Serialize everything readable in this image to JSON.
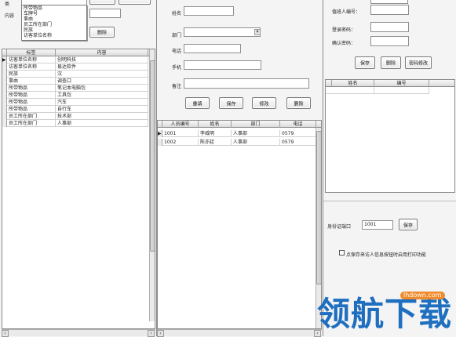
{
  "left": {
    "type_label": "类",
    "content_label": "内容",
    "combo_value": "",
    "dropdown_options": [
      "所带物品",
      "车牌号",
      "事由",
      "员工所在部门",
      "民族",
      "访客单位名称"
    ],
    "btn_top1": "",
    "btn_top2": "",
    "delete_label": "删除",
    "grid": {
      "headers": [
        "标签",
        "内容"
      ],
      "rows": [
        [
          "访客单位名称",
          "创明科技"
        ],
        [
          "访客单位名称",
          "易达软件"
        ],
        [
          "民族",
          "汉"
        ],
        [
          "事由",
          "调查口"
        ],
        [
          "所带物品",
          "笔记本电脑包"
        ],
        [
          "所带物品",
          "工具包"
        ],
        [
          "所带物品",
          "汽车"
        ],
        [
          "所带物品",
          "自行车"
        ],
        [
          "员工所在部门",
          "技术部"
        ],
        [
          "员工所在部门",
          "人事部"
        ]
      ]
    }
  },
  "middle": {
    "name_label": "姓名",
    "dept_label": "部门",
    "phone_label": "电话",
    "mobile_label": "手机",
    "remark_label": "备注",
    "buttons": {
      "reset": "重填",
      "save": "保存",
      "modify": "修改",
      "delete": "删除"
    },
    "grid": {
      "headers": [
        "人员编号",
        "姓名",
        "部门",
        "电话"
      ],
      "rows": [
        [
          "1001",
          "李威明",
          "人事部",
          "0579"
        ],
        [
          "1002",
          "陈亦廷",
          "人事部",
          "0579"
        ]
      ]
    }
  },
  "right": {
    "id_label": "值班人编号：",
    "login_pwd_label": "登录密码：",
    "confirm_pwd_label": "确认密码：",
    "buttons": {
      "save": "保存",
      "delete": "删除",
      "change_pwd": "密码修改"
    },
    "grid": {
      "headers": [
        "姓名",
        "编号"
      ]
    },
    "id_port_label": "身份证端口",
    "id_port_value": "1001",
    "id_port_save": "保存",
    "print_checkbox_label": "点保存来访人信息按钮时启用打印功能",
    "print_checked": false
  },
  "watermark": {
    "text": "领航下载",
    "url": "lhdown.com"
  },
  "colors": {
    "watermark": "#1e6fbf",
    "border": "#8a8a8a",
    "panel_bg": "#f4f4f4"
  }
}
